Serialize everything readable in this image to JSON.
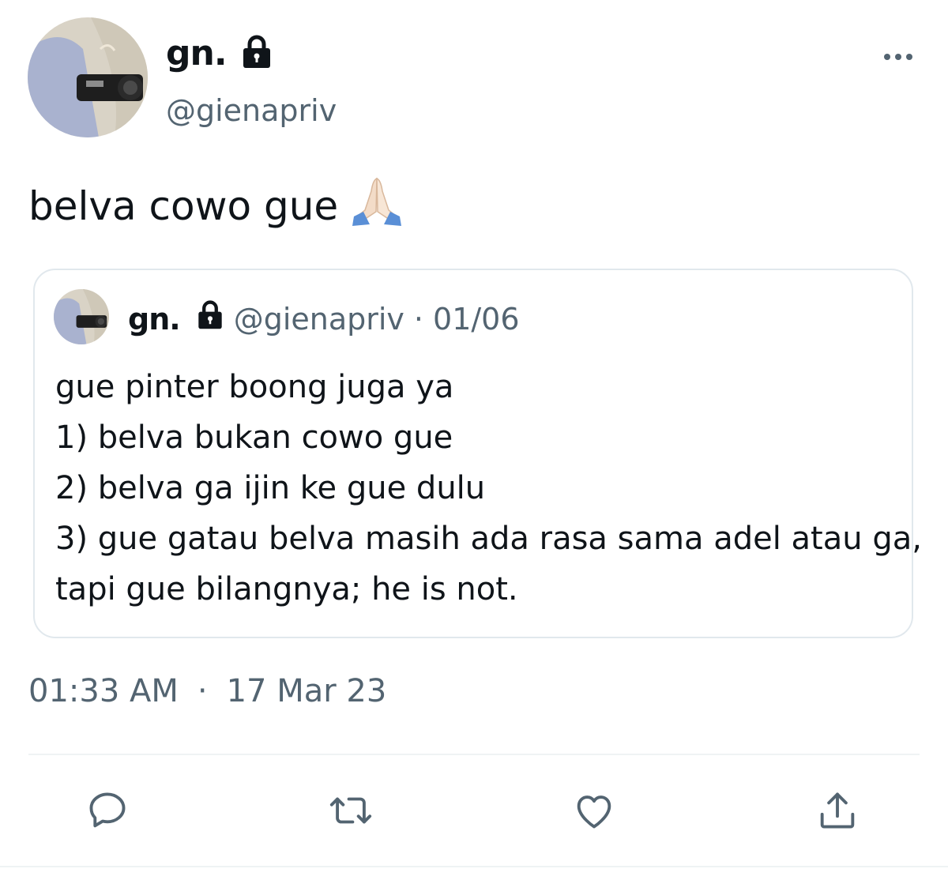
{
  "tweet": {
    "author": {
      "display_name": "gn.",
      "handle": "@gienapriv",
      "avatar_icon": "avatar-photo",
      "badge_icon": "lock-icon"
    },
    "text": "belva cowo gue",
    "emoji": "🙏🏻",
    "timestamp": {
      "time": "01:33 AM",
      "separator": "·",
      "date": "17 Mar 23"
    },
    "more_icon": "more-icon"
  },
  "quoted_tweet": {
    "author": {
      "display_name": "gn.",
      "handle": "@gienapriv",
      "badge_icon": "lock-icon"
    },
    "separator": "·",
    "date": "01/06",
    "lines": [
      "gue pinter boong juga ya",
      "1) belva bukan cowo gue",
      "2) belva ga ijin ke gue dulu",
      "3) gue gatau belva masih ada rasa sama adel atau ga,",
      "tapi gue bilangnya; he is not."
    ]
  },
  "actions": [
    {
      "icon": "reply-icon"
    },
    {
      "icon": "retweet-icon"
    },
    {
      "icon": "like-icon"
    },
    {
      "icon": "share-icon"
    }
  ],
  "colors": {
    "text": "#0f1419",
    "secondary": "#536471",
    "border": "#e1e8ed"
  }
}
